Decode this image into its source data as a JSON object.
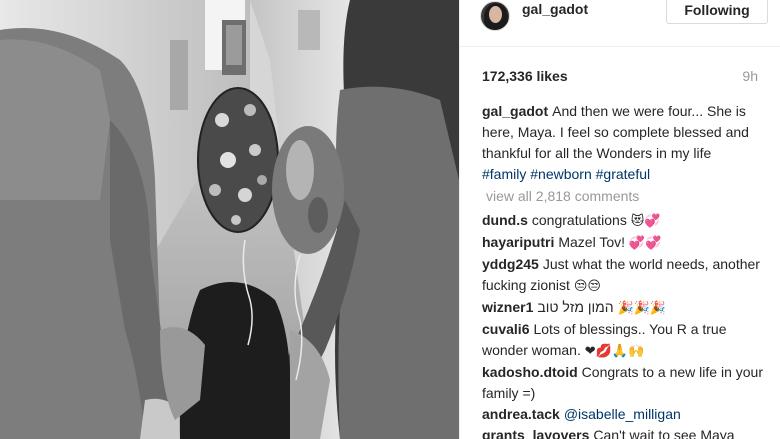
{
  "post": {
    "username": "gal_gadot",
    "follow_label": "Following",
    "likes": "172,336 likes",
    "time": "9h",
    "caption": {
      "user": "gal_gadot",
      "text": "And then we were four... She is here, Maya. I feel so complete blessed and thankful for all the Wonders in my life",
      "hashtags": [
        "#family",
        "#newborn",
        "#grateful"
      ]
    },
    "view_all": "view all 2,818 comments"
  },
  "comments": [
    {
      "user": "dund.s",
      "text": "congratulations",
      "emoji": "😻💞"
    },
    {
      "user": "hayariputri",
      "text": "Mazel Tov!",
      "emoji": "💞💞"
    },
    {
      "user": "yddg245",
      "text": "Just what the world needs, another fucking zionist",
      "emoji": "😒😒"
    },
    {
      "user": "wizner1",
      "text": "המון מזל טוב",
      "emoji": "🎉🎉🎉"
    },
    {
      "user": "cuvali6",
      "text": "Lots of blessings.. You R a true wonder woman.",
      "emoji": "❤💋🙏🙌"
    },
    {
      "user": "kadosho.dtoid",
      "text": "Congrats to a new life in your family =)",
      "emoji": ""
    },
    {
      "user": "andrea.tack",
      "text": "@isabelle_milligan",
      "emoji": ""
    },
    {
      "user": "grants_layovers",
      "text": "Can't wait to see Maya",
      "emoji": ""
    }
  ],
  "icons": {
    "avatar": "profile-avatar",
    "photo": "family-hallway-photo"
  },
  "colors": {
    "hashtag": "#003569",
    "muted": "#999999",
    "text": "#262626"
  }
}
